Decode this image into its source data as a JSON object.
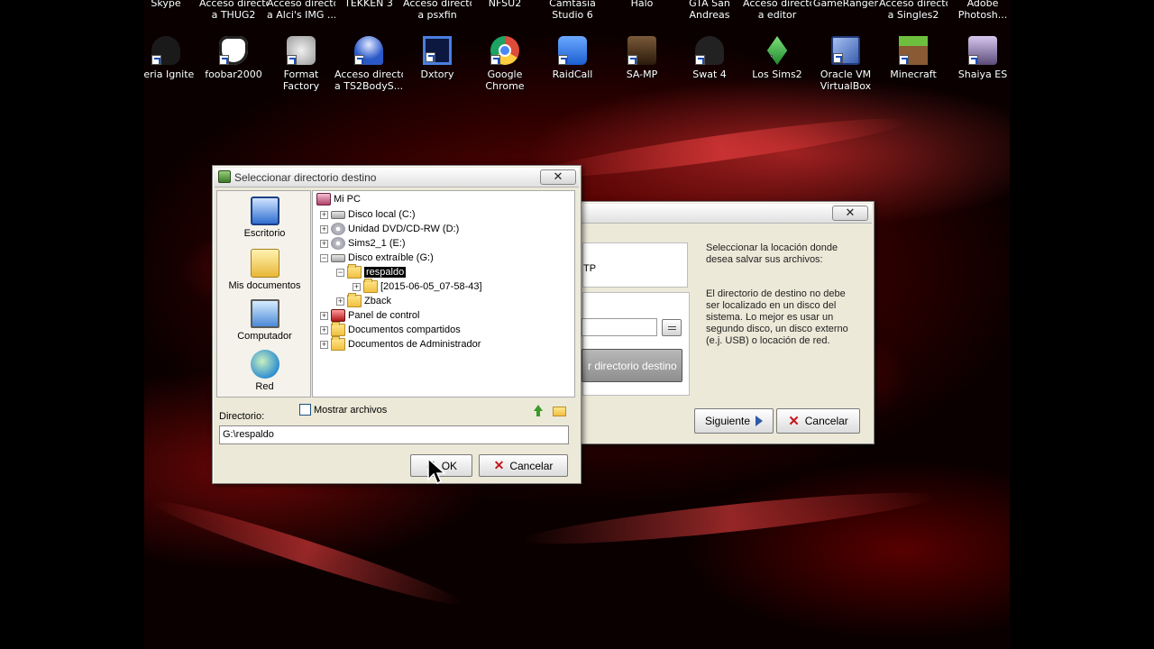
{
  "desktop": {
    "top_icons": [
      {
        "label1": "Skype",
        "label2": ""
      },
      {
        "label1": "Acceso directo",
        "label2": "a THUG2"
      },
      {
        "label1": "Acceso directo",
        "label2": "a Alci's IMG ..."
      },
      {
        "label1": "TEKKEN 3",
        "label2": ""
      },
      {
        "label1": "Acceso directo",
        "label2": "a psxfin"
      },
      {
        "label1": "NFSU2",
        "label2": ""
      },
      {
        "label1": "Camtasia",
        "label2": "Studio 6"
      },
      {
        "label1": "Halo",
        "label2": ""
      },
      {
        "label1": "GTA San",
        "label2": "Andreas"
      },
      {
        "label1": "Acceso directo",
        "label2": "a editor"
      },
      {
        "label1": "GameRanger",
        "label2": ""
      },
      {
        "label1": "Acceso directo",
        "label2": "a Singles2"
      },
      {
        "label1": "Adobe",
        "label2": "Photosh..."
      }
    ],
    "icons": [
      {
        "label1": "aeria Ignite",
        "label2": "",
        "icon": "aeria-ignite-icon",
        "color": "#1a1a1a"
      },
      {
        "label1": "foobar2000",
        "label2": "",
        "icon": "foobar2000-icon",
        "color": "#ffffff"
      },
      {
        "label1": "Format",
        "label2": "Factory",
        "icon": "format-factory-icon",
        "color": "#c8c8c8"
      },
      {
        "label1": "Acceso directo",
        "label2": "a TS2BodyS...",
        "icon": "ts2bodyshop-icon",
        "color": "#2a58c8"
      },
      {
        "label1": "Dxtory",
        "label2": "",
        "icon": "dxtory-icon",
        "color": "#1b2f6e"
      },
      {
        "label1": "Google",
        "label2": "Chrome",
        "icon": "chrome-icon",
        "color": "#dd4b39"
      },
      {
        "label1": "RaidCall",
        "label2": "",
        "icon": "raidcall-icon",
        "color": "#3a7be0"
      },
      {
        "label1": "SA-MP",
        "label2": "",
        "icon": "samp-icon",
        "color": "#6a4a2a"
      },
      {
        "label1": "Swat 4",
        "label2": "",
        "icon": "swat4-icon",
        "color": "#222222"
      },
      {
        "label1": "Los Sims2",
        "label2": "",
        "icon": "sims2-icon",
        "color": "#3bb34a"
      },
      {
        "label1": "Oracle VM",
        "label2": "VirtualBox",
        "icon": "virtualbox-icon",
        "color": "#6b8fd6"
      },
      {
        "label1": "Minecraft",
        "label2": "",
        "icon": "minecraft-icon",
        "color": "#5c9a3b"
      },
      {
        "label1": "Shaiya ES",
        "label2": "",
        "icon": "shaiya-icon",
        "color": "#b0a0c8"
      }
    ]
  },
  "back_window": {
    "close": "✕",
    "fragment_tp": "TP",
    "info_title": "Seleccionar la locación donde desea salvar sus archivos:",
    "info_line1": "El directorio de destino no debe",
    "info_line2": "ser localizado en un disco del",
    "info_line3": "sistema. Lo mejor es usar un",
    "info_line4": "segundo disco, un disco externo",
    "info_line5": "(e.j. USB) o locación de red.",
    "dest_button": "r directorio destino",
    "next_button": "Siguiente",
    "cancel_button": "Cancelar"
  },
  "dialog": {
    "title": "Seleccionar directorio destino",
    "close": "✕",
    "places": [
      {
        "label": "Escritorio",
        "icon": "desktop-icon"
      },
      {
        "label": "Mis documentos",
        "icon": "my-documents-icon"
      },
      {
        "label": "Computador",
        "icon": "computer-icon"
      },
      {
        "label": "Red",
        "icon": "network-icon"
      }
    ],
    "tree": [
      {
        "label": "Mi PC",
        "indent": 0,
        "expander": "",
        "kind": "pc"
      },
      {
        "label": "Disco local (C:)",
        "indent": 1,
        "expander": "+",
        "kind": "drive"
      },
      {
        "label": "Unidad DVD/CD-RW (D:)",
        "indent": 1,
        "expander": "+",
        "kind": "cd"
      },
      {
        "label": "Sims2_1 (E:)",
        "indent": 1,
        "expander": "+",
        "kind": "cd"
      },
      {
        "label": "Disco extraíble (G:)",
        "indent": 1,
        "expander": "−",
        "kind": "drive"
      },
      {
        "label": "respaldo",
        "indent": 2,
        "expander": "−",
        "kind": "folder",
        "selected": true
      },
      {
        "label": "[2015-06-05_07-58-43]",
        "indent": 3,
        "expander": "+",
        "kind": "folder"
      },
      {
        "label": "Zback",
        "indent": 2,
        "expander": "+",
        "kind": "folder"
      },
      {
        "label": "Panel de control",
        "indent": 1,
        "expander": "+",
        "kind": "control"
      },
      {
        "label": "Documentos compartidos",
        "indent": 1,
        "expander": "+",
        "kind": "folder"
      },
      {
        "label": "Documentos de Administrador",
        "indent": 1,
        "expander": "+",
        "kind": "folder"
      }
    ],
    "show_files_label": "Mostrar archivos",
    "show_files_checked": false,
    "directory_label": "Directorio:",
    "directory_value": "G:\\respaldo",
    "ok_button": "OK",
    "cancel_button": "Cancelar"
  }
}
